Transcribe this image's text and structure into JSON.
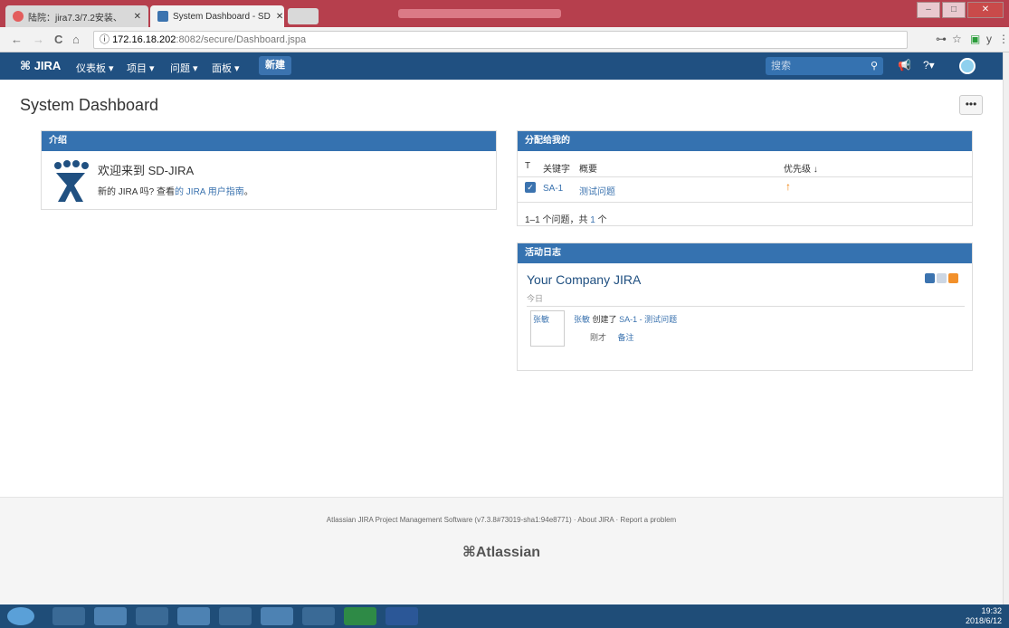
{
  "browser": {
    "tabs": [
      {
        "title": "陆院：jira7.3/7.2安装、",
        "active": false
      },
      {
        "title": "System Dashboard - SD",
        "active": true
      }
    ],
    "tab_close": "✕",
    "url_host": "172.16.18.202",
    "url_path": ":8082/secure/Dashboard.jspa",
    "back": "←",
    "forward": "→",
    "reload": "C",
    "home": "⌂",
    "info": "ⓘ",
    "key_icon": "⊶",
    "star_icon": "☆",
    "ext_icon": "▣",
    "ext_y": "y",
    "menu_icon": "⋮",
    "min": "–",
    "max": "□",
    "close": "✕"
  },
  "header": {
    "logo": "JIRA",
    "menus": [
      "仪表板 ▾",
      "项目 ▾",
      "问题 ▾",
      "面板 ▾"
    ],
    "create": "新建",
    "search_placeholder": "搜索",
    "search_icon": "⚲",
    "feedback_icon": "📢",
    "help_icon": "?▾"
  },
  "page": {
    "title": "System Dashboard",
    "more": "•••"
  },
  "intro": {
    "header": "介绍",
    "title": "欢迎来到 SD-JIRA",
    "text_prefix": "新的 JIRA 吗? 查看",
    "link": "的 JIRA 用户指南",
    "text_suffix": "。"
  },
  "assigned": {
    "header": "分配给我的",
    "columns": [
      "T",
      "关键字",
      "概要",
      "优先级 ↓"
    ],
    "rows": [
      {
        "key": "SA-1",
        "summary": "测试问题",
        "priority_icon": "↑"
      }
    ],
    "count_prefix": "1–1 个问题，共",
    "count_total": "1",
    "count_suffix": "个"
  },
  "activity": {
    "header": "活动日志",
    "title": "Your Company JIRA",
    "today": "今日",
    "img_alt": "张敏",
    "user": "张敏",
    "action": "创建了",
    "issue": "SA-1 - 测试问题",
    "time": "刚才",
    "comment": "备注"
  },
  "footer": {
    "text": "Atlassian JIRA Project Management Software (v7.3.8#73019-sha1:94e8771)  ·  About JIRA  ·  Report a problem",
    "logo": "Atlassian"
  },
  "taskbar": {
    "time": "19:32",
    "date": "2018/6/12"
  },
  "colors": {
    "jira_header": "#205081",
    "gadget_header": "#3572b0",
    "link": "#3b73af"
  }
}
